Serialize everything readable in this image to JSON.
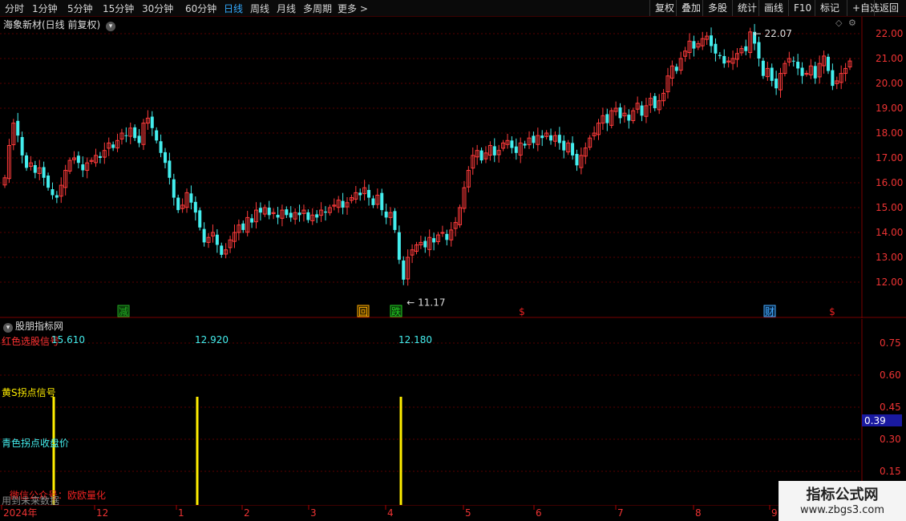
{
  "toolbar": {
    "periods": [
      "分时",
      "1分钟",
      "5分钟",
      "15分钟",
      "30分钟",
      "60分钟",
      "日线",
      "周线",
      "月线",
      "多周期",
      "更多 >"
    ],
    "active": "日线",
    "right_buttons": [
      "复权",
      "叠加",
      "多股",
      "统计",
      "画线",
      "F10",
      "+自选",
      "返回"
    ],
    "mark_label": "标记"
  },
  "stock": {
    "title": "海象新材(日线 前复权)",
    "high_label": "22.07",
    "low_label": "11.17"
  },
  "price_axis": [
    "22.00",
    "21.00",
    "20.00",
    "19.00",
    "18.00",
    "17.00",
    "16.00",
    "15.00",
    "14.00",
    "13.00",
    "12.00"
  ],
  "event_markers": [
    {
      "text": "减",
      "color": "#2a2",
      "bg": "#0a3a0a"
    },
    {
      "text": "回",
      "color": "#fa0",
      "bg": "#3a2a00"
    },
    {
      "text": "跌",
      "color": "#2c2",
      "bg": "#0a3a0a"
    },
    {
      "text": "$",
      "color": "#e22",
      "bg": ""
    },
    {
      "text": "财",
      "color": "#4af",
      "bg": "#0a2a4a"
    },
    {
      "text": "$",
      "color": "#e22",
      "bg": ""
    }
  ],
  "indicator": {
    "title": "股朋指标网",
    "red_signal_label": "红色选股信号",
    "values": [
      "15.610",
      "12.920",
      "12.180"
    ],
    "yellow_label": "黄S拐点信号",
    "cyan_label": "青色拐点收盘价",
    "promo": "微信公众号：欧欧量化",
    "future_note": "用到未来数据",
    "axis": [
      "0.75",
      "0.60",
      "0.45",
      "0.30",
      "0.15"
    ],
    "cursor_value": "0.39"
  },
  "x_axis": [
    "2024年",
    "12",
    "1",
    "2",
    "3",
    "4",
    "5",
    "6",
    "7",
    "8",
    "9"
  ],
  "watermark": {
    "line1": "指标公式网",
    "line2": "www.zbgs3.com"
  },
  "colors": {
    "up": "#ff3b3b",
    "down": "#4ee",
    "yellow": "#ffee00",
    "grid": "#5a0000"
  },
  "chart_data": {
    "type": "candlestick",
    "y_range": [
      11.0,
      22.4
    ],
    "closes": [
      16.2,
      17.5,
      18.4,
      17.9,
      17.1,
      16.6,
      16.8,
      16.4,
      16.6,
      16.2,
      15.8,
      15.5,
      15.4,
      15.9,
      16.5,
      16.9,
      17.0,
      16.8,
      16.5,
      16.8,
      16.9,
      17.1,
      17.0,
      17.3,
      17.6,
      17.4,
      17.7,
      18.0,
      17.9,
      18.2,
      17.8,
      17.6,
      18.4,
      18.6,
      18.2,
      17.7,
      17.2,
      16.8,
      16.2,
      15.4,
      14.9,
      15.1,
      15.6,
      15.2,
      14.8,
      14.2,
      13.6,
      13.8,
      14.0,
      13.5,
      13.1,
      13.3,
      13.7,
      14.0,
      14.3,
      14.1,
      14.6,
      14.4,
      14.9,
      14.8,
      15.0,
      14.7,
      14.8,
      14.6,
      14.9,
      14.7,
      14.6,
      14.8,
      14.7,
      14.9,
      14.5,
      14.7,
      14.6,
      14.9,
      14.8,
      15.0,
      15.1,
      15.3,
      15.0,
      15.2,
      15.4,
      15.6,
      15.5,
      15.8,
      15.4,
      15.1,
      15.5,
      14.9,
      14.6,
      14.8,
      14.1,
      12.9,
      12.1,
      13.0,
      13.3,
      13.5,
      13.6,
      13.4,
      13.8,
      13.6,
      13.9,
      14.0,
      13.7,
      14.1,
      14.4,
      15.0,
      15.8,
      16.5,
      17.1,
      17.3,
      16.9,
      17.2,
      17.5,
      17.1,
      17.3,
      17.6,
      17.7,
      17.4,
      17.2,
      17.6,
      17.5,
      17.8,
      17.6,
      17.9,
      17.8,
      18.0,
      17.7,
      17.9,
      17.6,
      17.3,
      17.6,
      17.1,
      16.7,
      17.1,
      17.4,
      17.8,
      18.0,
      18.4,
      18.7,
      18.4,
      18.9,
      19.0,
      18.6,
      18.8,
      18.5,
      18.9,
      19.2,
      18.7,
      19.1,
      19.4,
      19.0,
      19.3,
      19.6,
      20.3,
      20.7,
      20.5,
      21.0,
      21.3,
      21.7,
      21.4,
      21.6,
      21.8,
      21.9,
      21.5,
      21.2,
      21.1,
      20.8,
      20.9,
      21.0,
      21.2,
      21.4,
      21.3,
      22.07,
      21.6,
      21.0,
      20.3,
      20.6,
      20.1,
      19.8,
      20.4,
      20.8,
      21.0,
      20.9,
      20.6,
      20.3,
      20.4,
      20.7,
      20.2,
      20.8,
      21.1,
      20.5,
      19.9,
      20.1,
      20.4,
      20.6,
      20.9
    ]
  }
}
